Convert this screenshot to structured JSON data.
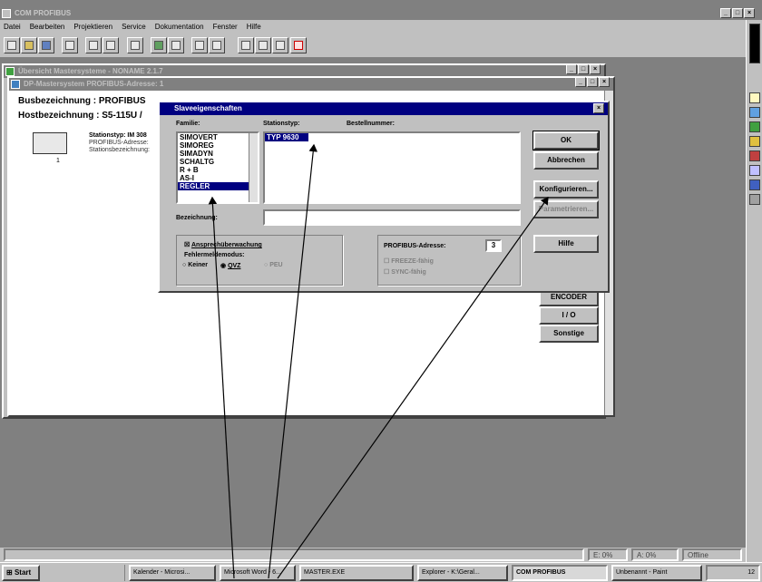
{
  "app": {
    "title": "COM PROFIBUS",
    "menu": [
      "Datei",
      "Bearbeiten",
      "Projektieren",
      "Service",
      "Dokumentation",
      "Fenster",
      "Hilfe"
    ]
  },
  "windows": {
    "outer_title": "Übersicht Mastersysteme - NONAME 2.1.7",
    "inner_title": "DP-Mastersystem PROFIBUS-Adresse: 1",
    "bus_label": "Busbezeichnung : PROFIBUS",
    "host_label": "Hostbezeichnung : S5-115U /",
    "station_type": "Stationstyp: IM 308",
    "station_addr": "PROFIBUS-Adresse:",
    "station_name": "Stationsbezeichnung:",
    "station_num": "1"
  },
  "side_buttons": [
    "ENCODER",
    "I / O",
    "Sonstige"
  ],
  "dialog": {
    "title": "Slaveeigenschaften",
    "family_label": "Familie:",
    "families": [
      "SIMOVERT",
      "SIMOREG",
      "SIMADYN",
      "SCHALTG",
      "R + B",
      "AS-I",
      "REGLER"
    ],
    "selected_family": "REGLER",
    "stationstyp_label": "Stationstyp:",
    "stationstyp_items": [
      "TYP 9630"
    ],
    "bestellnummer_label": "Bestellnummer:",
    "bezeichnung_label": "Bezeichnung:",
    "bezeichnung_value": "",
    "buttons": {
      "ok": "OK",
      "cancel": "Abbrechen",
      "configure": "Konfigurieren...",
      "params": "Parametrieren...",
      "help": "Hilfe"
    },
    "watchdog_label": "Ansprechüberwachung",
    "error_mode_label": "Fehlermeldemodus:",
    "error_modes": [
      "Keiner",
      "QVZ",
      "PEU"
    ],
    "profibus_label": "PROFIBUS-Adresse:",
    "profibus_value": "3",
    "freeze_label": "FREEZE-fähig",
    "sync_label": "SYNC-fähig"
  },
  "statusbar": {
    "e": "E: 0%",
    "a": "A: 0%",
    "mode": "Offline"
  },
  "taskbar": {
    "start": "Start",
    "tasks": [
      "Kalender - Microsi...",
      "Microsoft Word - 6...",
      "MASTER.EXE",
      "Explorer - K:\\Geral...",
      "COM PROFIBUS",
      "Unbenannt - Paint"
    ],
    "clock": "12"
  },
  "colors": {
    "title_active": "#000080",
    "desktop": "#808080",
    "face": "#c0c0c0"
  }
}
